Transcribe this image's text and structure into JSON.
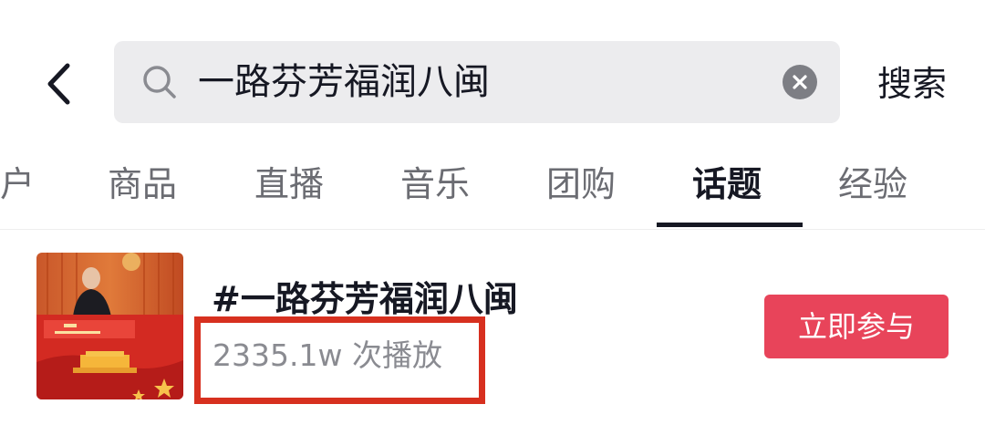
{
  "header": {
    "back_icon": "chevron-left-icon",
    "search": {
      "icon": "search-icon",
      "query": "一路芬芳福润八闽",
      "clear_icon": "close-circle-icon"
    },
    "search_button": "搜索"
  },
  "tabs": [
    {
      "label": "户",
      "active": false
    },
    {
      "label": "商品",
      "active": false
    },
    {
      "label": "直播",
      "active": false
    },
    {
      "label": "音乐",
      "active": false
    },
    {
      "label": "团购",
      "active": false
    },
    {
      "label": "话题",
      "active": true
    },
    {
      "label": "经验",
      "active": false
    }
  ],
  "result": {
    "title": "#一路芬芳福润八闽",
    "plays": "2335.1w 次播放",
    "join_button": "立即参与"
  },
  "colors": {
    "accent": "#e8445a",
    "annotation_box": "#d7301f",
    "search_bg": "#ececee",
    "text_primary": "#161823",
    "text_secondary": "#8a8b91"
  }
}
